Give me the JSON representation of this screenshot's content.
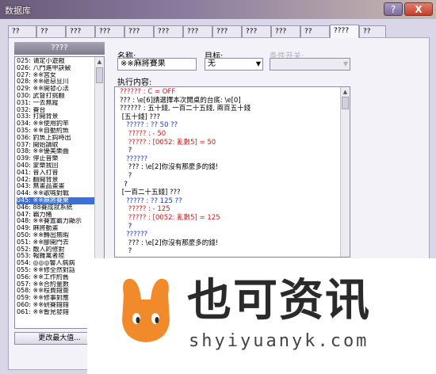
{
  "window": {
    "title": "数据库",
    "help_label": "?",
    "close_label": "X"
  },
  "tabs": [
    "??",
    "??",
    "???",
    "???",
    "???",
    "???",
    "???",
    "???",
    "???",
    "???",
    "??",
    "????",
    "??"
  ],
  "active_tab_index": 11,
  "list": {
    "header": "????",
    "rows": [
      "025: 请定小遊戲",
      "026: 八門進甲訣竅",
      "027: ※※宮女",
      "028: ※※砸惡旦川",
      "029: ※※開發心法",
      "030: 武督打挑翻",
      "031: 一去無蹤",
      "032: 賽台",
      "033: 打開背景",
      "034: ※※使用釣竿",
      "035: ※※自動約魚",
      "036: 釣魚上鈎時出",
      "037: 開始讀取",
      "038: ※※優美樂曲",
      "039: 停止音樂",
      "040: 蒙樂我回",
      "041: 音入打音",
      "042: 翻開背景",
      "043: 無畫品畫畫",
      "044: ※※歌喊對戰",
      "045: ※※麻將賽果",
      "046: 88賽成就系統",
      "047: 霸力賭",
      "048: ※※賽置霸力顯示",
      "049: 麻將動畫",
      "050: ※※轉出無暇",
      "051: ※※腳開門去",
      "052: 敵人的修對",
      "053: 報雜禽者陸",
      "054: ◎◎◎響人病病",
      "055: ※※修全然對話",
      "056: ※※工作約舊",
      "057: ※※合約量數",
      "058: ※※程費錯簽",
      "059: ※※修事對應",
      "060: ※※研賽錯錯",
      "061: ※※暫見發錯"
    ],
    "selected_index": 20,
    "max_button": "更改最大值..."
  },
  "form": {
    "name_label": "名称:",
    "name_value": "※※麻將賽果",
    "target_label": "目标:",
    "target_value": "无",
    "switch_label": "条件开关:",
    "contents_label": "执行内容:"
  },
  "commands": [
    {
      "text": "?????? : C = OFF",
      "color": "red"
    },
    {
      "text": "??? : \\e[6]請選擇本次開桌的台底: \\e[0]",
      "color": "dark"
    },
    {
      "text": "?????? : 五十錢, 一百二十五錢, 兩百五十錢",
      "color": "dark"
    },
    {
      "text": " [五十錢] ???",
      "color": "dark"
    },
    {
      "text": "   ????? : ?? 50 ??",
      "color": "blue"
    },
    {
      "text": "    ????? : - 50",
      "color": "red"
    },
    {
      "text": "    ????? : [0052: 亂數5] = 50",
      "color": "red"
    },
    {
      "text": "    ?",
      "color": "dark"
    },
    {
      "text": "   ??????",
      "color": "blue"
    },
    {
      "text": "    ??? : \\e[2]你沒有那麼多的錢!",
      "color": "dark"
    },
    {
      "text": "    ?",
      "color": "dark"
    },
    {
      "text": "  ?",
      "color": "dark"
    },
    {
      "text": " [一百二十五錢] ???",
      "color": "dark"
    },
    {
      "text": "   ????? : ?? 125 ??",
      "color": "blue"
    },
    {
      "text": "    ????? : - 125",
      "color": "red"
    },
    {
      "text": "    ????? : [0052: 亂數5] = 125",
      "color": "red"
    },
    {
      "text": "    ?",
      "color": "dark"
    },
    {
      "text": "   ??????",
      "color": "blue"
    },
    {
      "text": "    ??? : \\e[2]你沒有那麼多的錢!",
      "color": "dark"
    },
    {
      "text": "    ?",
      "color": "dark"
    }
  ],
  "watermark": {
    "text": "也可资讯",
    "url": "shyiyuanyk.com",
    "logo_color": "#f08a2a"
  }
}
